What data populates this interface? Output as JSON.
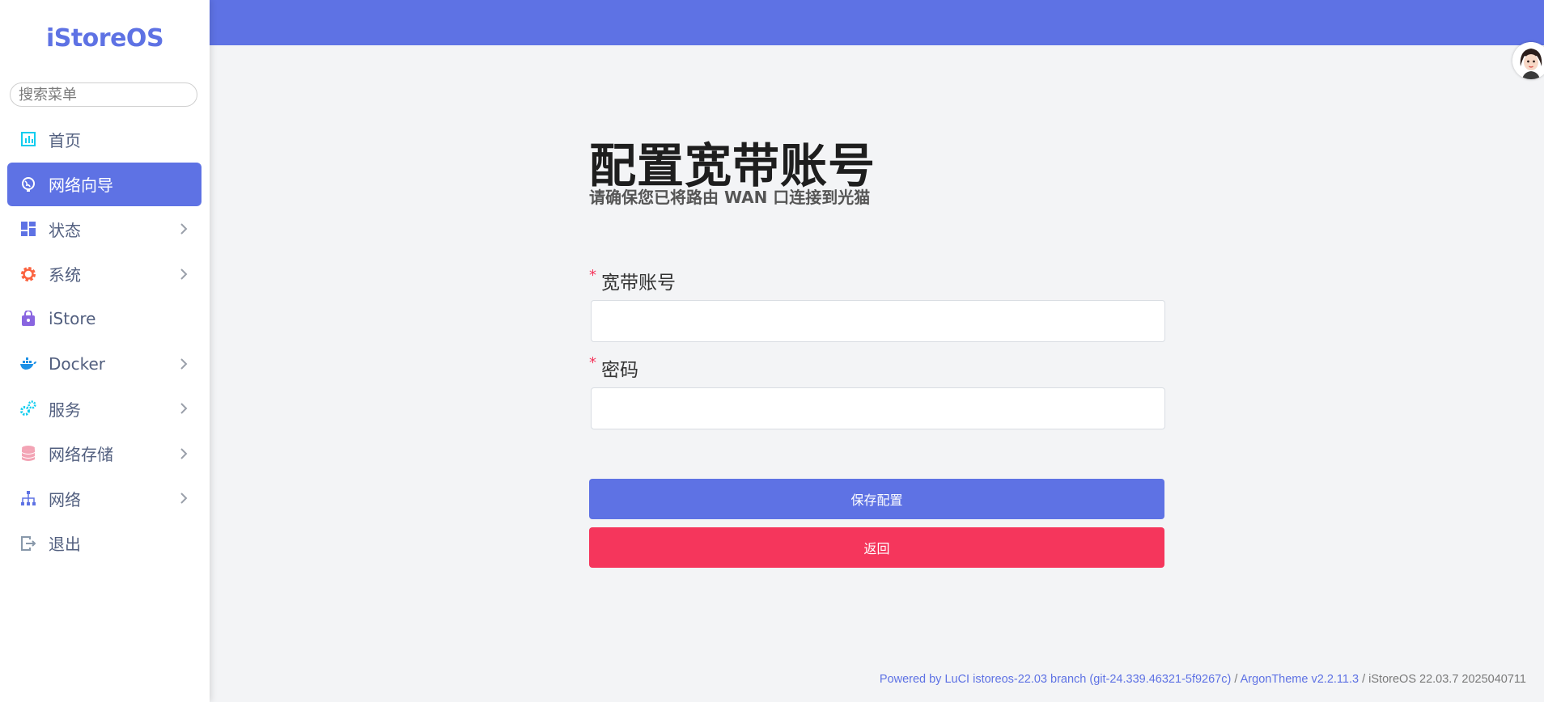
{
  "app": {
    "logo_text": "iStoreOS"
  },
  "search": {
    "placeholder": "搜索菜单"
  },
  "sidebar": {
    "items": [
      {
        "label": "首页",
        "icon": "dashboard-chart-icon",
        "active": false,
        "has_submenu": false
      },
      {
        "label": "网络向导",
        "icon": "globe-icon",
        "active": true,
        "has_submenu": false
      },
      {
        "label": "状态",
        "icon": "grid-icon",
        "active": false,
        "has_submenu": true
      },
      {
        "label": "系统",
        "icon": "gear-icon",
        "active": false,
        "has_submenu": true
      },
      {
        "label": "iStore",
        "icon": "shopping-bag-icon",
        "active": false,
        "has_submenu": false
      },
      {
        "label": "Docker",
        "icon": "docker-whale-icon",
        "active": false,
        "has_submenu": true
      },
      {
        "label": "服务",
        "icon": "cogs-icon",
        "active": false,
        "has_submenu": true
      },
      {
        "label": "网络存储",
        "icon": "database-icon",
        "active": false,
        "has_submenu": true
      },
      {
        "label": "网络",
        "icon": "network-tree-icon",
        "active": false,
        "has_submenu": true
      },
      {
        "label": "退出",
        "icon": "logout-icon",
        "active": false,
        "has_submenu": false
      }
    ]
  },
  "main": {
    "title": "配置宽带账号",
    "subtitle": "请确保您已将路由 WAN 口连接到光猫",
    "fields": [
      {
        "required_mark": "*",
        "label": "宽带账号",
        "value": "",
        "type": "text"
      },
      {
        "required_mark": "*",
        "label": "密码",
        "value": "",
        "type": "password"
      }
    ],
    "save_label": "保存配置",
    "back_label": "返回"
  },
  "footer": {
    "powered": "Powered by LuCI istoreos-22.03 branch (git-24.339.46321-5f9267c)",
    "sep1": " / ",
    "theme": "ArgonTheme v2.2.11.3",
    "sep2": " / ",
    "version": "iStoreOS 22.03.7 2025040711"
  },
  "colors": {
    "accent": "#5e72e4",
    "danger": "#f5365c",
    "background": "#f3f4f6"
  }
}
